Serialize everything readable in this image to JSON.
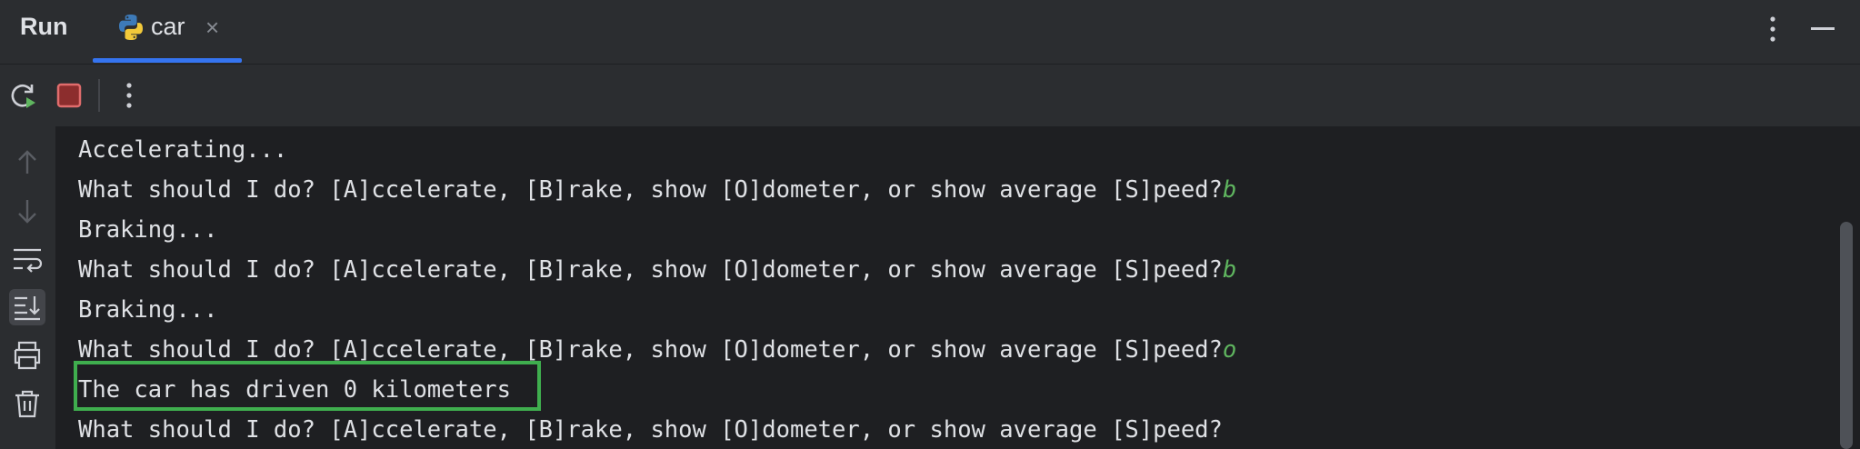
{
  "header": {
    "title": "Run",
    "tab": {
      "label": "car",
      "close_glyph": "×",
      "icon": "python-icon"
    }
  },
  "toolbar": {
    "buttons": [
      "rerun-icon",
      "stop-icon",
      "more-vertical-icon"
    ]
  },
  "sidebar": {
    "buttons": [
      "arrow-up-icon",
      "arrow-down-icon",
      "soft-wrap-icon",
      "scroll-to-end-icon",
      "print-icon",
      "trash-icon"
    ]
  },
  "console": {
    "lines": [
      {
        "text": "Accelerating...",
        "input": ""
      },
      {
        "text": "What should I do? [A]ccelerate, [B]rake, show [O]dometer, or show average [S]peed?",
        "input": "b"
      },
      {
        "text": "Braking...",
        "input": ""
      },
      {
        "text": "What should I do? [A]ccelerate, [B]rake, show [O]dometer, or show average [S]peed?",
        "input": "b"
      },
      {
        "text": "Braking...",
        "input": ""
      },
      {
        "text": "What should I do? [A]ccelerate, [B]rake, show [O]dometer, or show average [S]peed?",
        "input": "o"
      },
      {
        "text": "The car has driven 0 kilometers",
        "input": ""
      },
      {
        "text": "What should I do? [A]ccelerate, [B]rake, show [O]dometer, or show average [S]peed?",
        "input": ""
      }
    ]
  },
  "colors": {
    "accent": "#3574f0",
    "highlight": "#3fae4e",
    "input_text": "#5fb55f",
    "stop": "#e06c6c"
  }
}
